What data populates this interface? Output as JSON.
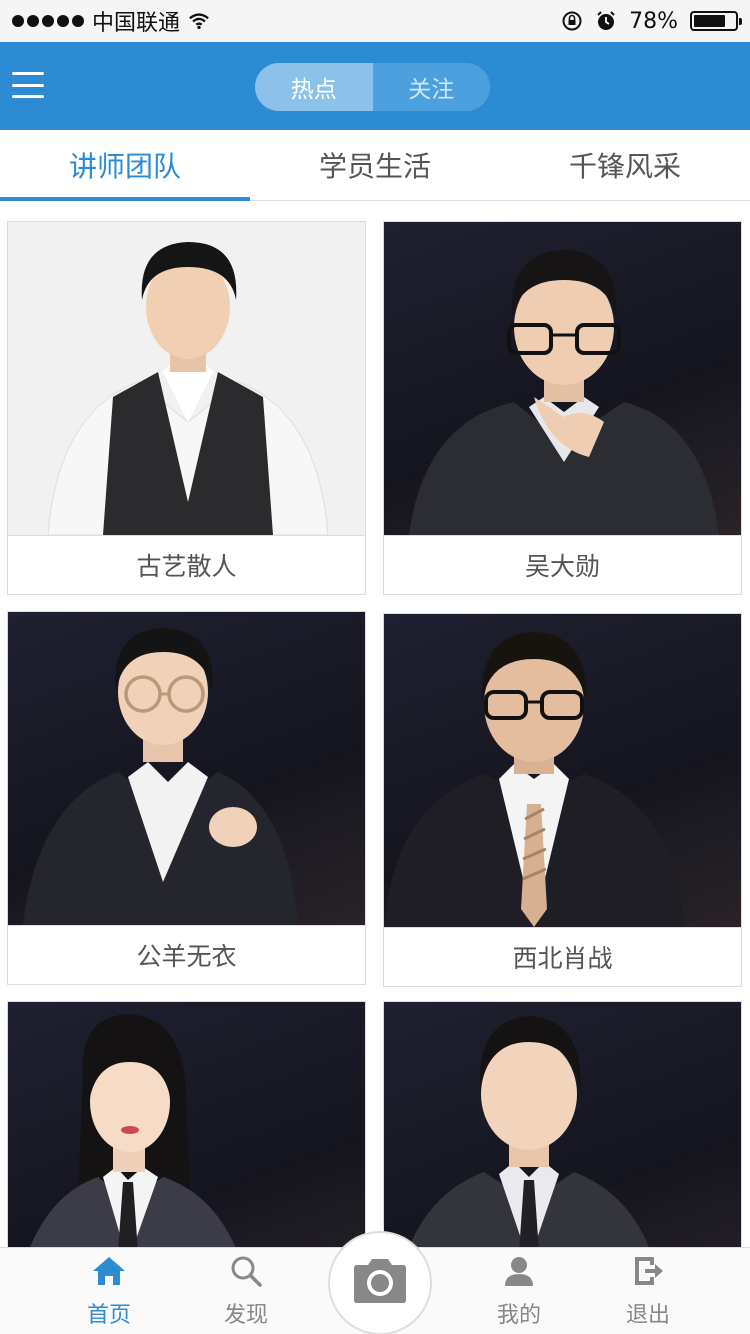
{
  "status_bar": {
    "carrier": "中国联通",
    "battery": "78%",
    "battery_level": 0.78
  },
  "header": {
    "menu_icon": "hamburger-menu-icon",
    "segments": [
      {
        "label": "热点",
        "active": true
      },
      {
        "label": "关注",
        "active": false
      }
    ]
  },
  "tabs": [
    {
      "label": "讲师团队",
      "active": true
    },
    {
      "label": "学员生活",
      "active": false
    },
    {
      "label": "千锋风采",
      "active": false
    }
  ],
  "teachers": [
    {
      "name": "古艺散人"
    },
    {
      "name": "吴大勋"
    },
    {
      "name": "公羊无衣"
    },
    {
      "name": "西北肖战"
    },
    {
      "name": ""
    },
    {
      "name": ""
    }
  ],
  "bottom_nav": {
    "items": [
      {
        "label": "首页",
        "icon": "home-icon",
        "active": true
      },
      {
        "label": "发现",
        "icon": "search-icon",
        "active": false
      },
      {
        "label": "我的",
        "icon": "user-icon",
        "active": false
      },
      {
        "label": "退出",
        "icon": "logout-icon",
        "active": false
      }
    ],
    "camera_icon": "camera-icon"
  },
  "colors": {
    "accent": "#2d8bd3",
    "header_bg": "#2d8bd3"
  }
}
